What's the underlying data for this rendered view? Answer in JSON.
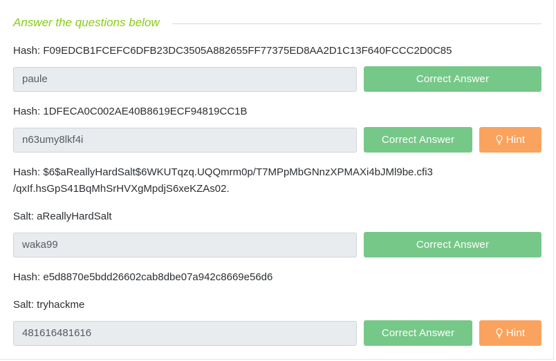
{
  "section": {
    "title": "Answer the questions below"
  },
  "questions": [
    {
      "lines": [
        "Hash: F09EDCB1FCEFC6DFB23DC3505A882655FF77375ED8AA2D1C13F640FCCC2D0C85"
      ],
      "answer": "paule",
      "button": "Correct Answer"
    },
    {
      "lines": [
        "Hash: 1DFECA0C002AE40B8619ECF94819CC1B"
      ],
      "answer": "n63umy8lkf4i",
      "button": "Correct Answer",
      "hint": "Hint"
    },
    {
      "lines": [
        "Hash: $6$aReallyHardSalt$6WKUTqzq.UQQmrm0p/T7MPpMbGNnzXPMAXi4bJMl9be.cfi3",
        "/qxIf.hsGpS41BqMhSrHVXgMpdjS6xeKZAs02.",
        "Salt: aReallyHardSalt"
      ],
      "answer": "waka99",
      "button": "Correct Answer"
    },
    {
      "lines": [
        "Hash: e5d8870e5bdd26602cab8dbe07a942c8669e56d6",
        "Salt: tryhackme"
      ],
      "answer": "481616481616",
      "button": "Correct Answer",
      "hint": "Hint"
    }
  ],
  "colors": {
    "section_title": "#88cc14",
    "correct_button": "#76c888",
    "hint_button": "#f9a35e",
    "input_background": "#e9ecef"
  },
  "icons": {
    "hint": "lightbulb-icon"
  }
}
